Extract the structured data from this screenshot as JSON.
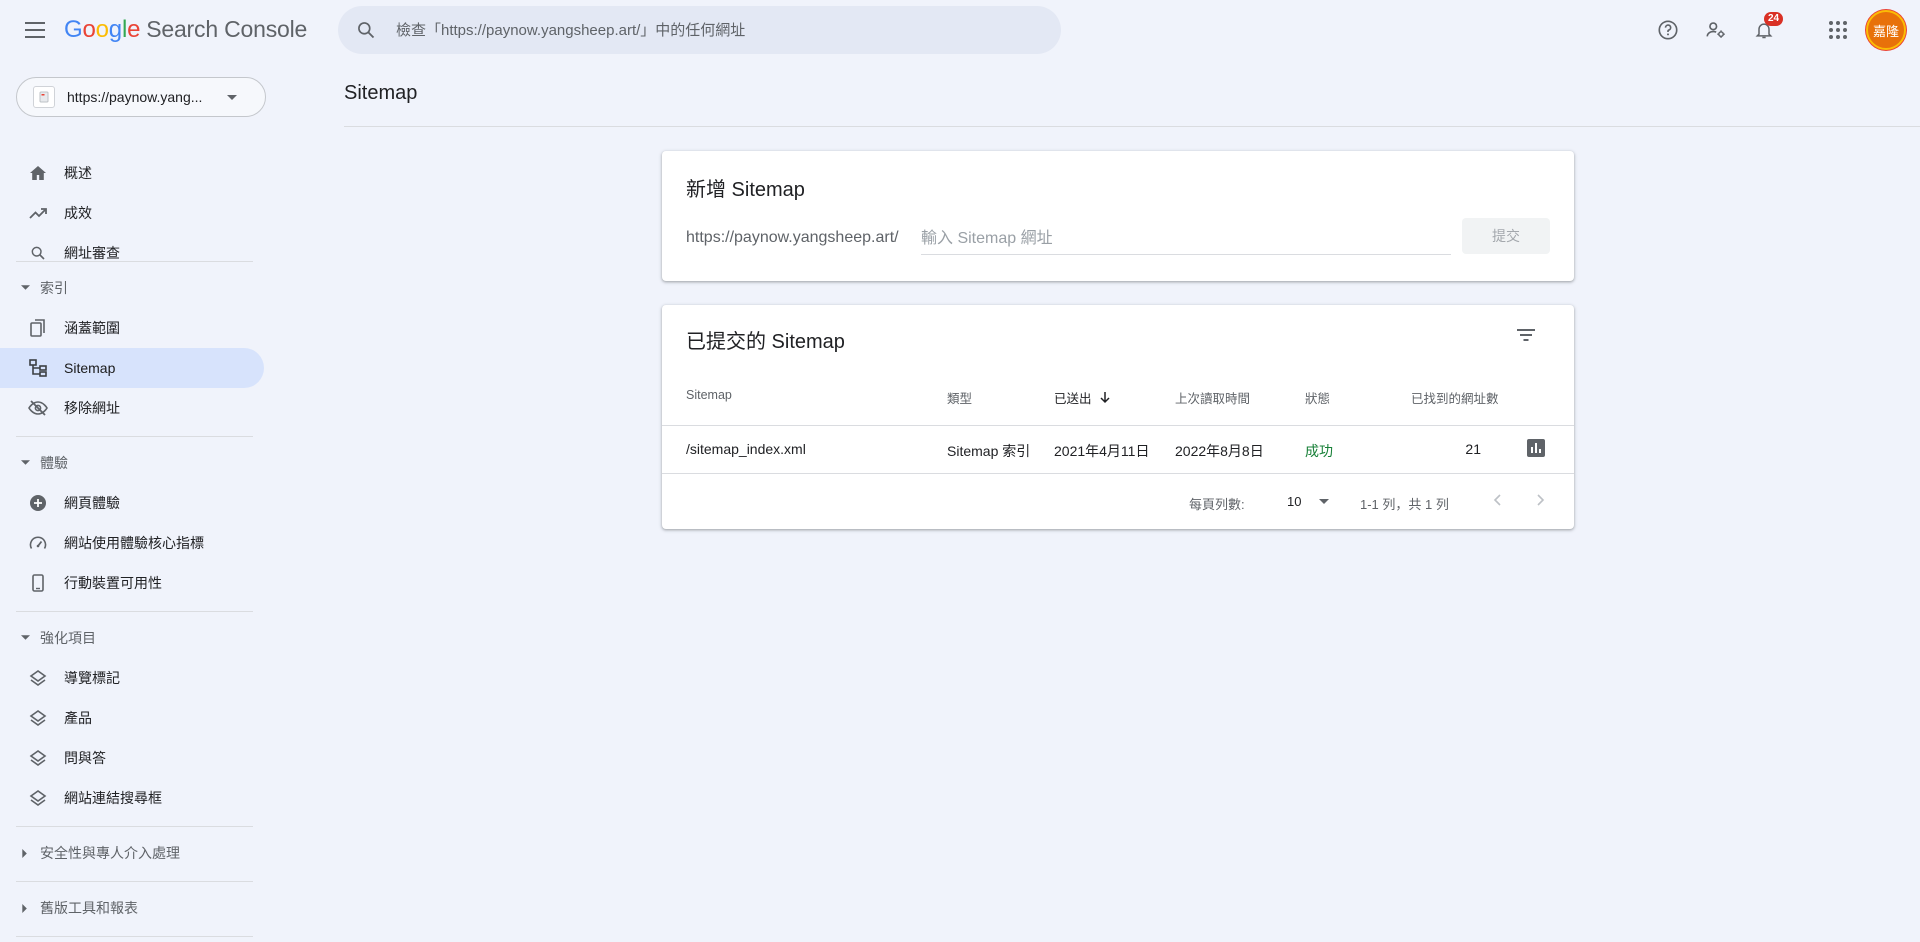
{
  "header": {
    "logo_letters": [
      "G",
      "o",
      "o",
      "g",
      "l",
      "e"
    ],
    "product_name": "Search Console",
    "search_placeholder": "檢查「https://paynow.yangsheep.art/」中的任何網址",
    "notification_count": "24",
    "avatar_text": "嘉隆"
  },
  "sidebar": {
    "property_label": "https://paynow.yang...",
    "top_items": [
      {
        "label": "概述",
        "icon": "home-icon"
      },
      {
        "label": "成效",
        "icon": "trending-up-icon"
      },
      {
        "label": "網址審查",
        "icon": "search-icon"
      }
    ],
    "sections": [
      {
        "label": "索引",
        "expanded": true,
        "items": [
          {
            "label": "涵蓋範圍",
            "icon": "copy-pages-icon"
          },
          {
            "label": "Sitemap",
            "icon": "sitemap-icon",
            "active": true
          },
          {
            "label": "移除網址",
            "icon": "eye-off-icon"
          }
        ]
      },
      {
        "label": "體驗",
        "expanded": true,
        "items": [
          {
            "label": "網頁體驗",
            "icon": "add-circle-icon"
          },
          {
            "label": "網站使用體驗核心指標",
            "icon": "speed-gauge-icon"
          },
          {
            "label": "行動裝置可用性",
            "icon": "phone-icon"
          }
        ]
      },
      {
        "label": "強化項目",
        "expanded": true,
        "items": [
          {
            "label": "導覽標記",
            "icon": "layers-icon"
          },
          {
            "label": "產品",
            "icon": "layers-icon"
          },
          {
            "label": "問與答",
            "icon": "layers-icon"
          },
          {
            "label": "網站連結搜尋框",
            "icon": "layers-icon"
          }
        ]
      },
      {
        "label": "安全性與專人介入處理",
        "expanded": false,
        "items": []
      },
      {
        "label": "舊版工具和報表",
        "expanded": false,
        "items": []
      }
    ]
  },
  "main": {
    "page_title": "Sitemap",
    "add_card": {
      "title": "新增 Sitemap",
      "prefix": "https://paynow.yangsheep.art/",
      "input_placeholder": "輸入 Sitemap 網址",
      "submit_label": "提交"
    },
    "list_card": {
      "title": "已提交的 Sitemap",
      "columns": [
        "Sitemap",
        "類型",
        "已送出",
        "上次讀取時間",
        "狀態",
        "已找到的網址數"
      ],
      "sorted_column": "已送出",
      "rows": [
        {
          "sitemap": "/sitemap_index.xml",
          "type": "Sitemap 索引",
          "submitted": "2021年4月11日",
          "last_read": "2022年8月8日",
          "status": "成功",
          "urls_found": "21"
        }
      ],
      "pager": {
        "rows_per_page_label": "每頁列數:",
        "rows_per_page": "10",
        "range": "1-1 列，共 1 列"
      }
    }
  },
  "colors": {
    "accent_active": "#d7e3fc",
    "status_success": "#188038",
    "badge": "#d93025"
  }
}
